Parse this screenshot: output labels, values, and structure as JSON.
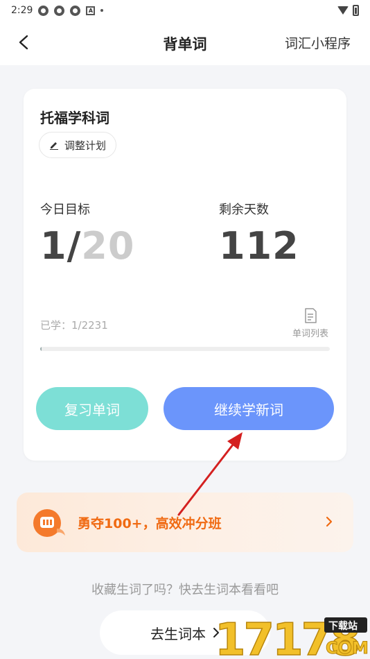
{
  "status_bar": {
    "time": "2:29"
  },
  "header": {
    "title": "背单词",
    "mini_program": "词汇小程序"
  },
  "card": {
    "book_title": "托福学科词",
    "adjust_plan": "调整计划",
    "today_goal_label": "今日目标",
    "today_done": "1/",
    "today_goal": "20",
    "remaining_days_label": "剩余天数",
    "remaining_days": "112",
    "learned": "已学：1/2231",
    "learned_progress": 0.00045,
    "word_list": "单词列表",
    "review_button": "复习单词",
    "continue_button": "继续学新词"
  },
  "promo": {
    "text": "勇夺100+，高效冲分班"
  },
  "vocab": {
    "prompt": "收藏生词了吗？快去生词本看看吧",
    "button": "去生词本"
  },
  "watermark": {
    "text": "17178",
    "badge": "下载站",
    "domain": "COM"
  },
  "colors": {
    "accent_blue": "#6b95fb",
    "accent_teal": "#7ddfd6",
    "promo_orange": "#f06a12",
    "annotation_red": "#d42020"
  }
}
